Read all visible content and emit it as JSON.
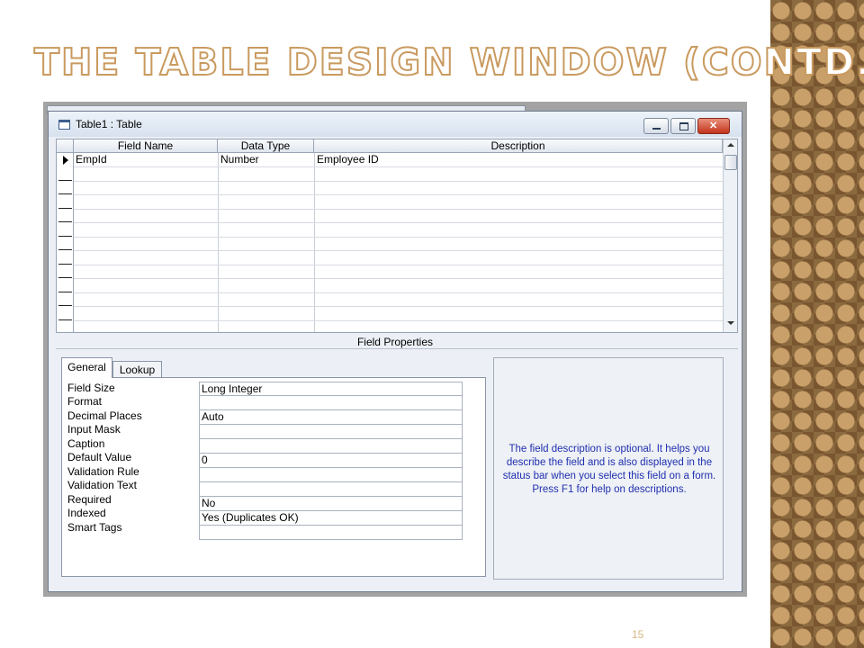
{
  "slide": {
    "title": "THE TABLE DESIGN WINDOW (CONTD.)",
    "page_number": "15"
  },
  "window": {
    "title": "Table1 : Table",
    "icon": "table-icon"
  },
  "grid": {
    "columns": [
      "Field Name",
      "Data Type",
      "Description"
    ],
    "rows": [
      {
        "field_name": "EmpId",
        "data_type": "Number",
        "description": "Employee ID"
      }
    ]
  },
  "field_properties": {
    "heading": "Field Properties",
    "tabs": [
      "General",
      "Lookup"
    ],
    "active_tab": "General",
    "properties": [
      {
        "label": "Field Size",
        "value": "Long Integer"
      },
      {
        "label": "Format",
        "value": ""
      },
      {
        "label": "Decimal Places",
        "value": "Auto"
      },
      {
        "label": "Input Mask",
        "value": ""
      },
      {
        "label": "Caption",
        "value": ""
      },
      {
        "label": "Default Value",
        "value": "0"
      },
      {
        "label": "Validation Rule",
        "value": ""
      },
      {
        "label": "Validation Text",
        "value": ""
      },
      {
        "label": "Required",
        "value": "No"
      },
      {
        "label": "Indexed",
        "value": "Yes (Duplicates OK)"
      },
      {
        "label": "Smart Tags",
        "value": ""
      }
    ],
    "help_text": "The field description is optional.  It helps you describe the field and is also displayed in the status bar when you select this field on a form.  Press F1 for help on descriptions."
  },
  "colors": {
    "title_outline": "#c99a5f",
    "help_text": "#1f2fb0",
    "close_button": "#c2331a"
  }
}
